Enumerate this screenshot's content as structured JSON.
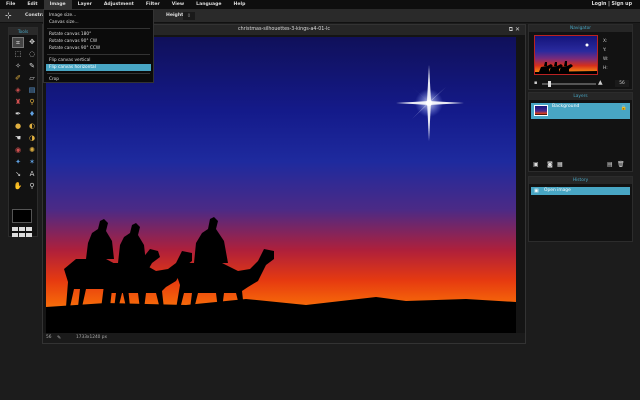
{
  "menubar": {
    "items": [
      "File",
      "Edit",
      "Image",
      "Layer",
      "Adjustment",
      "Filter",
      "View",
      "Language",
      "Help"
    ],
    "right": "Login | Sign up"
  },
  "optbar": {
    "constrain": "Constra",
    "height_label": "Height:",
    "height_value": "0"
  },
  "dropdown": {
    "items": [
      "Image size...",
      "Canvas size...",
      "Rotate canvas 180°",
      "Rotate canvas 90° CW",
      "Rotate canvas 90° CCW",
      "Flip canvas vertical",
      "Flip canvas horizontal",
      "Crop"
    ],
    "selected": "Flip canvas horizontal"
  },
  "tools": {
    "title": "Tools"
  },
  "canvas": {
    "filename": "christmas-silhouettes-3-kings-a4-01-lc",
    "zoom": "56",
    "dimensions": "1733x1240 px"
  },
  "navigator": {
    "title": "Navigator",
    "x_label": "X:",
    "y_label": "Y:",
    "w_label": "W:",
    "h_label": "H:",
    "zoom": "56"
  },
  "layers": {
    "title": "Layers",
    "items": [
      "Background"
    ]
  },
  "history": {
    "title": "History",
    "items": [
      "Open image"
    ]
  },
  "colors": {
    "accent": "#48a6c4",
    "panel_bg": "#121212"
  }
}
